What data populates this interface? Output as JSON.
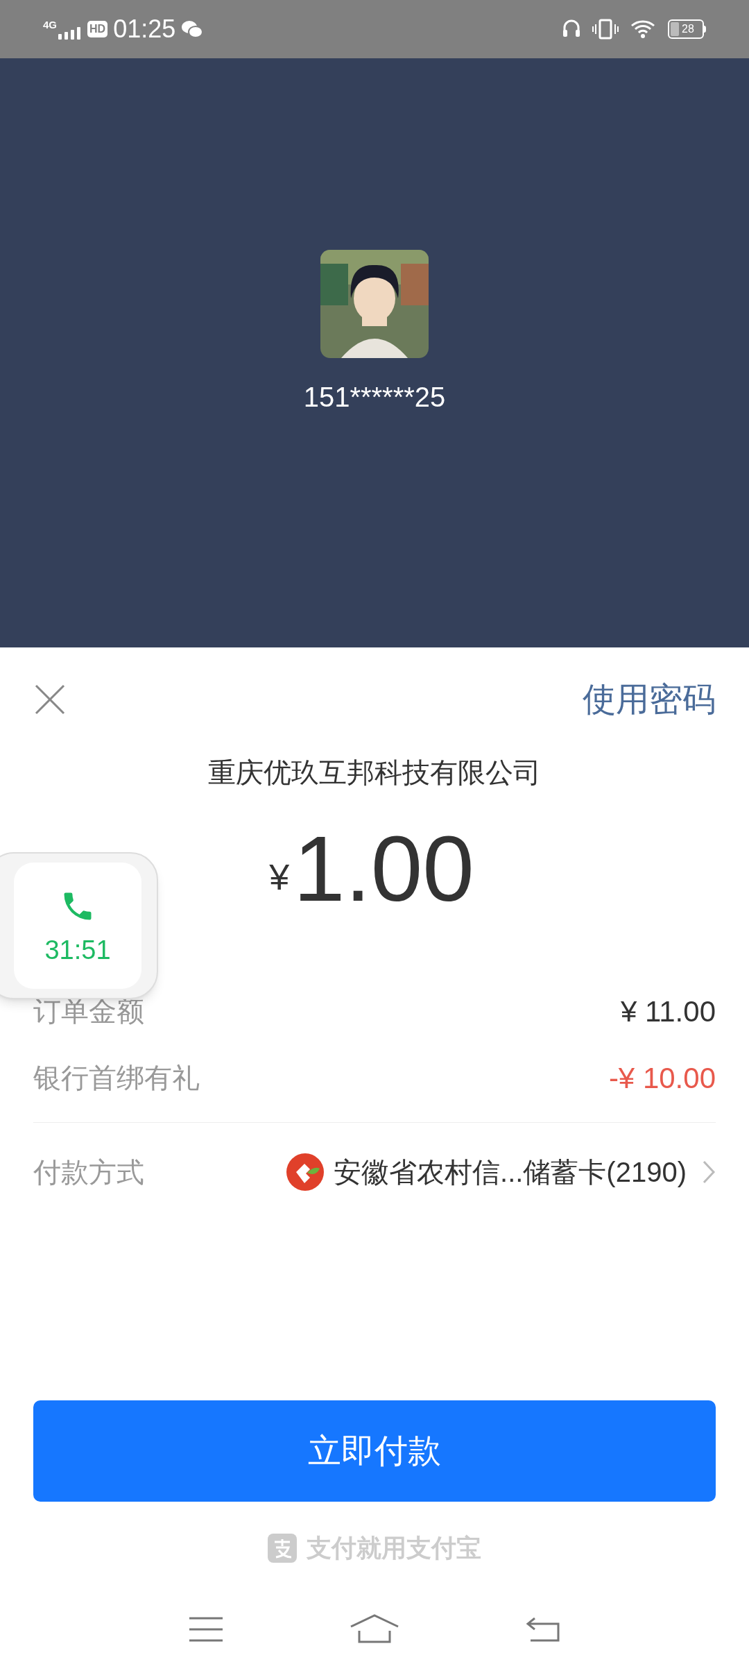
{
  "status_bar": {
    "network": "4G",
    "hd": "HD",
    "time": "01:25",
    "battery": "28"
  },
  "payee": {
    "account": "151******25"
  },
  "sheet": {
    "use_password": "使用密码",
    "merchant": "重庆优玖互邦科技有限公司",
    "currency": "¥",
    "amount": "1.00",
    "rows": [
      {
        "label": "订单金额",
        "value": "¥ 11.00",
        "kind": "plain"
      },
      {
        "label": "银行首绑有礼",
        "value": "-¥ 10.00",
        "kind": "discount"
      }
    ],
    "payment_method": {
      "label": "付款方式",
      "value": "安徽省农村信...储蓄卡(2190)"
    },
    "pay_button": "立即付款",
    "slogan": "支付就用支付宝"
  },
  "call_widget": {
    "duration": "31:51"
  }
}
